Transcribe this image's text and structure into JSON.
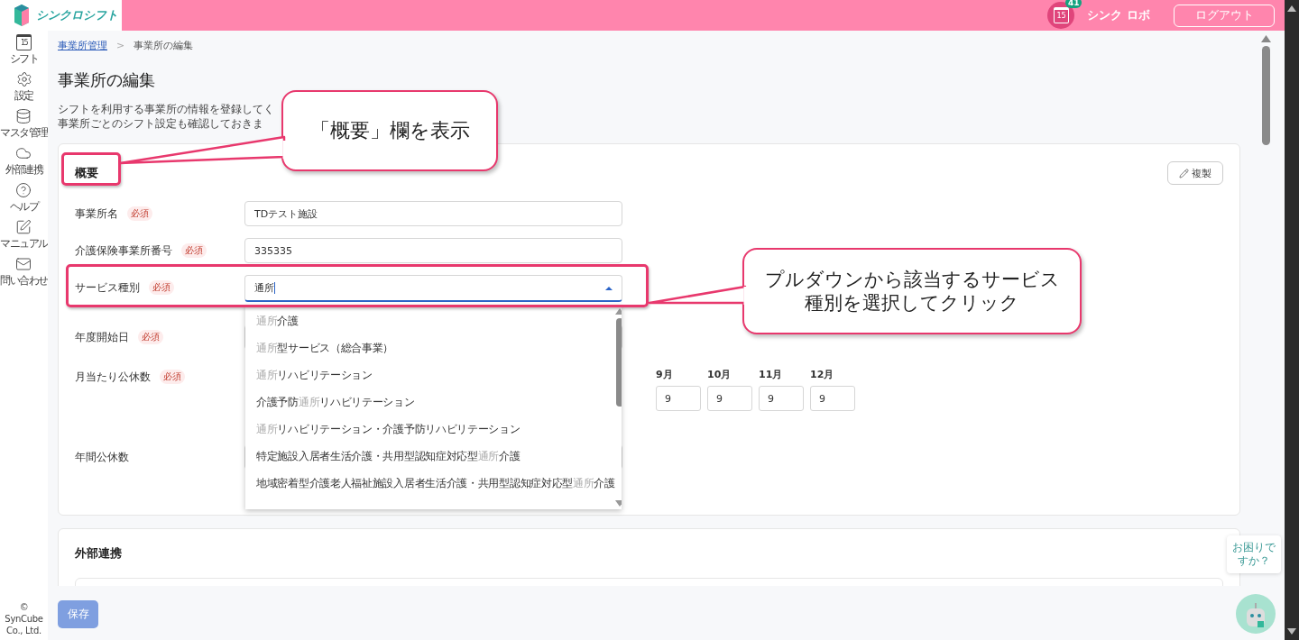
{
  "header": {
    "logo": "シンクロシフト",
    "calendar_day": "15",
    "notification_count": "41",
    "user_name": "シンク ロボ",
    "logout": "ログアウト"
  },
  "sidebar": {
    "items": [
      {
        "kind": "calendar",
        "label": "シフト",
        "day": "15"
      },
      {
        "kind": "gear",
        "label": "設定"
      },
      {
        "kind": "database",
        "label": "マスタ管理"
      },
      {
        "kind": "cloud",
        "label": "外部連携"
      },
      {
        "kind": "help",
        "label": "ヘルプ"
      },
      {
        "kind": "edit",
        "label": "マニュアル"
      },
      {
        "kind": "mail",
        "label": "問い合わせ"
      }
    ],
    "copyright": "© SynCube Co., Ltd."
  },
  "breadcrumb": {
    "items": [
      {
        "kind": "link",
        "label": "事業所管理"
      },
      {
        "kind": "current",
        "label": "事業所の編集"
      }
    ],
    "separator": ">"
  },
  "page_title": "事業所の編集",
  "description": [
    "シフトを利用する事業所の情報を登録してく",
    "事業所ごとのシフト設定も確認しておきま"
  ],
  "overview": {
    "title": "概要",
    "copy_button": "複製",
    "fields": [
      {
        "kind": "text",
        "label": "事業所名",
        "badge": "必須",
        "value": "TDテスト施設"
      },
      {
        "kind": "text",
        "label": "介護保険事業所番号",
        "badge": "必須",
        "value": "335335"
      },
      {
        "kind": "combobox",
        "label": "サービス種別",
        "badge": "必須",
        "value": "通所",
        "expanded": true,
        "options": [
          {
            "segments": [
              {
                "text": "通所",
                "match": true
              },
              {
                "text": "介護",
                "match": false
              }
            ]
          },
          {
            "segments": [
              {
                "text": "通所",
                "match": true
              },
              {
                "text": "型サービス（総合事業）",
                "match": false
              }
            ]
          },
          {
            "segments": [
              {
                "text": "通所",
                "match": true
              },
              {
                "text": "リハビリテーション",
                "match": false
              }
            ]
          },
          {
            "segments": [
              {
                "text": "介護予防",
                "match": false
              },
              {
                "text": "通所",
                "match": true
              },
              {
                "text": "リハビリテーション",
                "match": false
              }
            ]
          },
          {
            "segments": [
              {
                "text": "通所",
                "match": true
              },
              {
                "text": "リハビリテーション・介護予防リハビリテーション",
                "match": false
              }
            ]
          },
          {
            "segments": [
              {
                "text": "特定施設入居者生活介護・共用型認知症対応型",
                "match": false
              },
              {
                "text": "通所",
                "match": true
              },
              {
                "text": "介護",
                "match": false
              }
            ]
          },
          {
            "segments": [
              {
                "text": "地域密着型介護老人福祉施設入居者生活介護・共用型認知症対応型",
                "match": false
              },
              {
                "text": "通所",
                "match": true
              },
              {
                "text": "介護",
                "match": false
              }
            ]
          }
        ]
      },
      {
        "kind": "text",
        "label": "年度開始日",
        "badge": "必須"
      },
      {
        "kind": "months",
        "label": "月当たり公休数",
        "badge": "必須",
        "months": [
          {
            "label": "9月",
            "value": "9"
          },
          {
            "label": "10月",
            "value": "9"
          },
          {
            "label": "11月",
            "value": "9"
          },
          {
            "label": "12月",
            "value": "9"
          }
        ]
      },
      {
        "kind": "text",
        "label": "年間公休数"
      }
    ]
  },
  "external": {
    "title": "外部連携"
  },
  "footer": {
    "save": "保存",
    "disabled": true
  },
  "help_widget": {
    "text": "お困りですか？"
  },
  "annotations": [
    {
      "kind": "overview",
      "text": "「概要」欄を表示"
    },
    {
      "kind": "service",
      "text": "プルダウンから該当するサービス種別を選択してクリック"
    }
  ]
}
